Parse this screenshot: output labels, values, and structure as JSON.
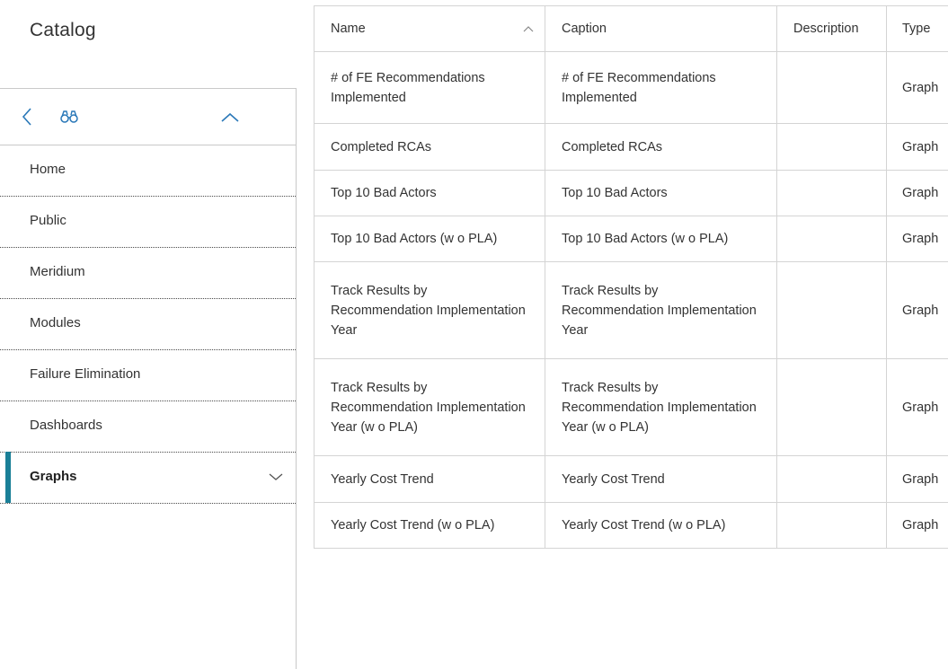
{
  "catalog": {
    "title": "Catalog"
  },
  "toolbar": {
    "back_icon": "chevron-left-icon",
    "search_icon": "binoculars-icon",
    "collapse_icon": "chevron-up-icon",
    "accent_color": "#2a78b8"
  },
  "nav": {
    "items": [
      {
        "label": "Home"
      },
      {
        "label": "Public"
      },
      {
        "label": "Meridium"
      },
      {
        "label": "Modules"
      },
      {
        "label": "Failure Elimination"
      },
      {
        "label": "Dashboards"
      },
      {
        "label": "Graphs",
        "active": true,
        "expand_icon": "chevron-down-icon"
      }
    ],
    "active_color": "#1a7f97"
  },
  "grid": {
    "columns": [
      "Name",
      "Caption",
      "Description",
      "Type"
    ],
    "sort_icon": "chevron-up-icon",
    "rows": [
      {
        "name": "# of FE Recommendations Implemented",
        "caption": "# of FE Recommendations Implemented",
        "description": "",
        "type": "Graph"
      },
      {
        "name": "Completed RCAs",
        "caption": "Completed RCAs",
        "description": "",
        "type": "Graph"
      },
      {
        "name": "Top 10 Bad Actors",
        "caption": "Top 10 Bad Actors",
        "description": "",
        "type": "Graph"
      },
      {
        "name": "Top 10 Bad Actors (w o PLA)",
        "caption": "Top 10 Bad Actors (w o PLA)",
        "description": "",
        "type": "Graph"
      },
      {
        "name": "Track Results by Recommendation Implementation Year",
        "caption": "Track Results by Recommendation Implementation Year",
        "description": "",
        "type": "Graph"
      },
      {
        "name": "Track Results by Recommendation Implementation Year (w o PLA)",
        "caption": "Track Results by Recommendation Implementation Year (w o PLA)",
        "description": "",
        "type": "Graph"
      },
      {
        "name": "Yearly Cost Trend",
        "caption": "Yearly Cost Trend",
        "description": "",
        "type": "Graph"
      },
      {
        "name": "Yearly Cost Trend (w o PLA)",
        "caption": "Yearly Cost Trend (w o PLA)",
        "description": "",
        "type": "Graph"
      }
    ]
  }
}
